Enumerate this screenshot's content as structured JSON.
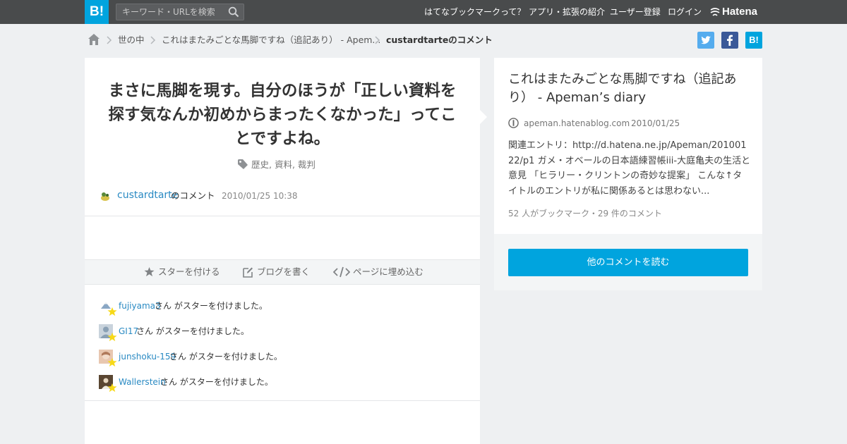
{
  "header": {
    "logo": "B!",
    "search_placeholder": "キーワード・URLを検索",
    "nav": [
      "はてなブックマークって？",
      "アプリ・拡張の紹介",
      "ユーザー登録",
      "ログイン"
    ],
    "brand": "Hatena"
  },
  "breadcrumb": {
    "items": [
      "世の中",
      "これはまたみごとな馬脚ですね（追記あり） - Apem..."
    ],
    "current": "custardtarteのコメント"
  },
  "social": {
    "twitter_color": "#55acee",
    "facebook_color": "#3b5998",
    "hatena_color": "#00a4de",
    "hatena_label": "B!"
  },
  "comment": {
    "text": "まさに馬脚を現す。自分のほうが「正しい資料を探す気なんか初めからまったくなかった」ってことですよね。",
    "tags": "歴史,  資料,  裁判",
    "user": "custardtarte",
    "user_suffix": "のコメント",
    "datetime": "2010/01/25 10:38"
  },
  "actions": [
    "スターを付ける",
    "ブログを書く",
    "ページに埋め込む"
  ],
  "stars": [
    {
      "user": "fujiyama3",
      "text": "さん がスターを付けました。"
    },
    {
      "user": "GI17",
      "text": "さん がスターを付けました。"
    },
    {
      "user": "junshoku-159",
      "text": "さん がスターを付けました。"
    },
    {
      "user": "Wallerstein",
      "text": "さん がスターを付けました。"
    }
  ],
  "entry": {
    "title": "これはまたみごとな馬脚ですね（追記あり） - Apeman’s diary",
    "domain": "apeman.hatenablog.com",
    "date": "2010/01/25",
    "excerpt": "関連エントリ：http://d.hatena.ne.jp/Apeman/20100122/p1 ガメ・オベールの日本語練習帳iii-大庭亀夫の生活と意見 「ヒラリー・クリントンの奇妙な提案」 こんな↑タイトルのエントリが私に関係あるとは思わない...",
    "counts": "52 人がブックマーク・29 件のコメント",
    "read_more": "他のコメントを読む"
  },
  "colors": {
    "accent": "#00a4de",
    "link": "#2a8ac3",
    "topbar": "#494b4c"
  }
}
